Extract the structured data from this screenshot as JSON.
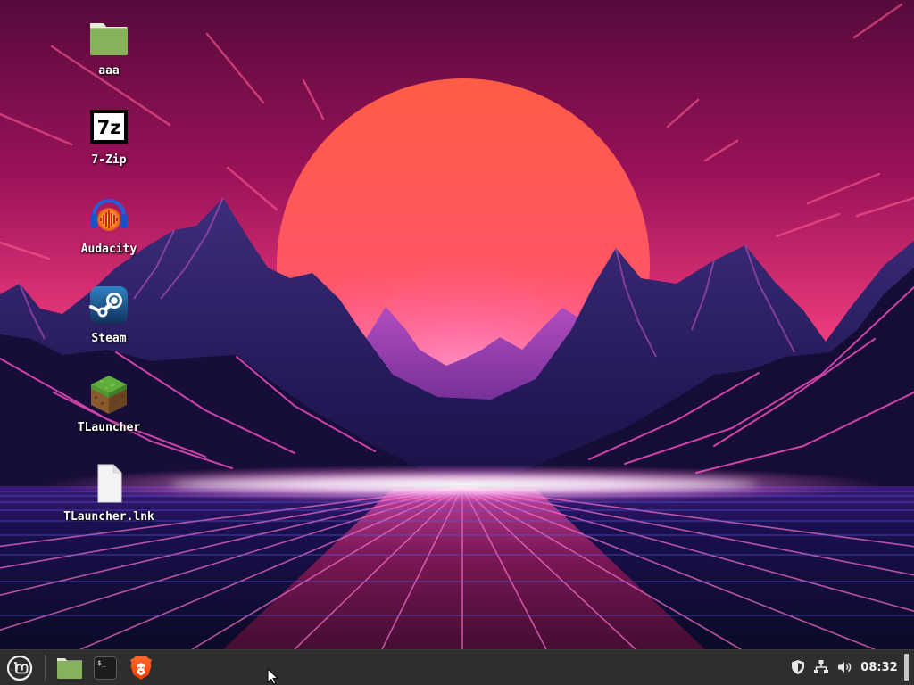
{
  "desktop": {
    "icons": [
      {
        "label": "aaa",
        "icon": "folder-icon"
      },
      {
        "label": "7-Zip",
        "icon": "7zip-icon",
        "logo_text": "7z"
      },
      {
        "label": "Audacity",
        "icon": "audacity-icon"
      },
      {
        "label": "Steam",
        "icon": "steam-icon"
      },
      {
        "label": "TLauncher",
        "icon": "tlauncher-grass-block-icon"
      },
      {
        "label": "TLauncher.lnk",
        "icon": "file-icon"
      }
    ]
  },
  "taskbar": {
    "menu_icon": "linux-mint-menu-icon",
    "launchers": [
      {
        "icon": "folder-icon"
      },
      {
        "icon": "terminal-icon",
        "glyph": "$_"
      },
      {
        "icon": "brave-browser-icon"
      }
    ],
    "tray": {
      "icons": [
        "shield-icon",
        "network-icon",
        "volume-icon"
      ],
      "clock": "08:32"
    },
    "show_desktop": {
      "icon": "show-desktop-bar-icon"
    }
  },
  "colors": {
    "taskbar_bg": "#2e2e2e",
    "label_text": "#ffffff",
    "folder_green": "#86b35a",
    "sky_top": "#560a3c",
    "sky_horizon": "#ee3b7d",
    "sun_top": "#ff5c46",
    "sun_bottom": "#ff4c9c",
    "grid_line": "#ff70d0",
    "grid_horizontal": "#5a5ad8"
  }
}
